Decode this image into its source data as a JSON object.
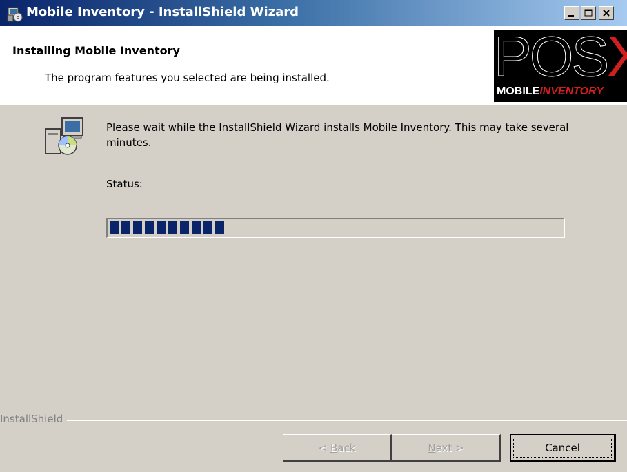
{
  "window": {
    "title": "Mobile Inventory - InstallShield Wizard",
    "controls": [
      "minimize-icon",
      "maximize-icon",
      "close-icon"
    ]
  },
  "header": {
    "title": "Installing Mobile Inventory",
    "subtitle": "The program features you selected are being installed.",
    "logo": {
      "main_prefix": "POS",
      "main_x": "X",
      "sub_white": "MOBILE",
      "sub_red": "INVENTORY",
      "colors": {
        "background": "#000000",
        "accent": "#d01f1f"
      }
    }
  },
  "body": {
    "icon": "installer-computer-cd-icon",
    "message": "Please wait while the InstallShield Wizard installs Mobile Inventory. This may take several minutes.",
    "status_label": "Status:",
    "progress": {
      "blocks_filled": 10,
      "fraction": 0.27,
      "color": "#0a246a"
    }
  },
  "footer": {
    "brand": "InstallShield",
    "buttons": {
      "back": {
        "label_prefix": "< ",
        "accel": "B",
        "label_rest": "ack",
        "enabled": false
      },
      "next": {
        "accel": "N",
        "label_rest": "ext >",
        "enabled": false
      },
      "cancel": {
        "label": "Cancel",
        "enabled": true,
        "default": true
      }
    }
  },
  "colors": {
    "titlebar_start": "#0a246a",
    "titlebar_end": "#a6caf0",
    "face": "#d4d0c8"
  }
}
